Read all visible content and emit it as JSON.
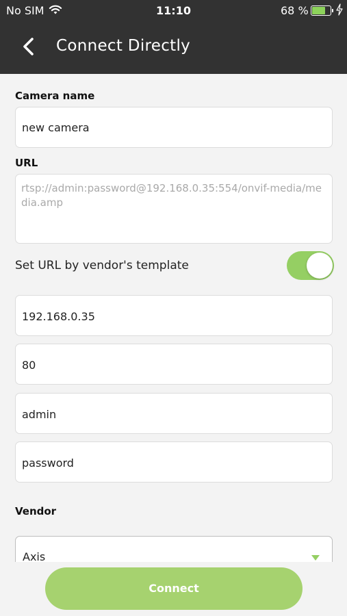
{
  "status_bar": {
    "carrier": "No SIM",
    "time": "11:10",
    "battery_percent": "68 %",
    "battery_level": 0.68
  },
  "header": {
    "title": "Connect Directly"
  },
  "form": {
    "camera_name_label": "Camera name",
    "camera_name_value": "new camera",
    "url_label": "URL",
    "url_placeholder": "rtsp://admin:password@192.168.0.35:554/onvif-media/media.amp",
    "template_toggle_label": "Set URL by vendor's template",
    "template_toggle_on": true,
    "ip_value": "192.168.0.35",
    "port_value": "80",
    "username_value": "admin",
    "password_value": "password",
    "vendor_label": "Vendor",
    "vendor_value": "Axis"
  },
  "actions": {
    "connect_label": "Connect"
  },
  "colors": {
    "header_bg": "#323232",
    "accent_green": "#95cf63",
    "button_green": "#a6d26f",
    "page_bg": "#f3f3f3"
  }
}
